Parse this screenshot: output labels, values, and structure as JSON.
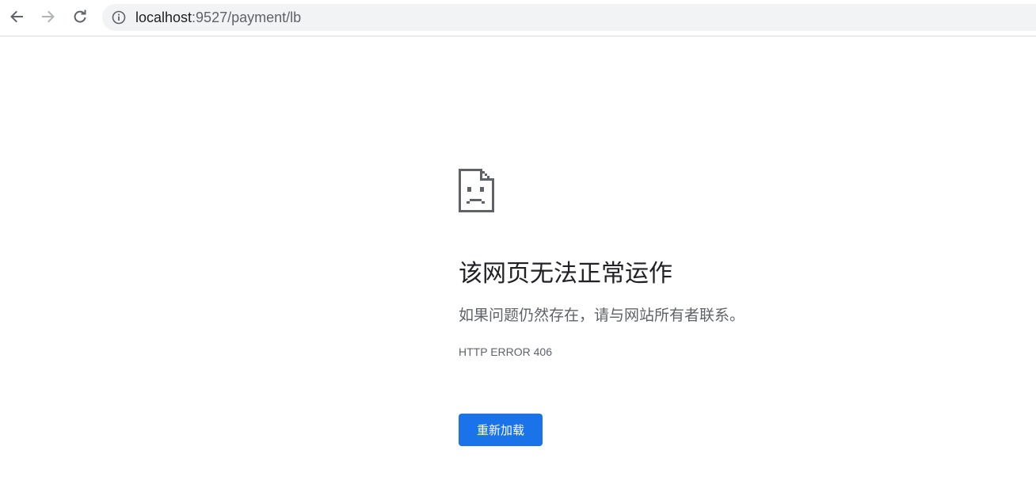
{
  "browser": {
    "back_icon": "arrow-left-icon",
    "forward_icon": "arrow-right-icon",
    "reload_icon": "reload-icon",
    "info_icon": "info-circle-icon",
    "url_host": "localhost",
    "url_path": ":9527/payment/lb"
  },
  "error_page": {
    "icon": "sad-page-icon",
    "heading": "该网页无法正常运作",
    "message": "如果问题仍然存在，请与网站所有者联系。",
    "error_code": "HTTP ERROR 406",
    "reload_button_label": "重新加载"
  },
  "colors": {
    "accent": "#1a73e8",
    "heading_text": "#202124",
    "secondary_text": "#5f6368",
    "omnibox_bg": "#f1f3f4"
  }
}
